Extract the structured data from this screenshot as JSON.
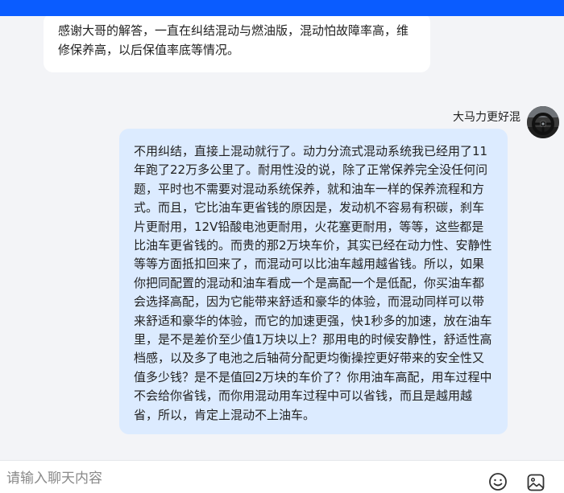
{
  "messages": {
    "first": {
      "text": "感谢大哥的解答，一直在纠结混动与燃油版，混动怕故障率高，维修保养高，以后保值率底等情况。"
    },
    "reply": {
      "sender": "大马力更好混",
      "avatar_icon": "car-steering-wheel-avatar",
      "text": "不用纠结，直接上混动就行了。动力分流式混动系统我已经用了11年跑了22万多公里了。耐用性没的说，除了正常保养完全没任何问题，平时也不需要对混动系统保养，就和油车一样的保养流程和方式。而且，它比油车更省钱的原因是，发动机不容易有积碳，刹车片更耐用，12V铅酸电池更耐用，火花塞更耐用，等等，这些都是比油车更省钱的。而贵的那2万块车价，其实已经在动力性、安静性等等方面抵扣回来了，而混动可以比油车越用越省钱。所以，如果你把同配置的混动和油车看成一个是高配一个是低配，你买油车都会选择高配，因为它能带来舒适和豪华的体验，而混动同样可以带来舒适和豪华的体验，而它的加速更强，快1秒多的加速，放在油车里，是不是差价至少值1万块以上？那用电的时候安静性，舒适性高档感，以及多了电池之后轴荷分配更均衡操控更好带来的安全性又值多少钱？是不是值回2万块的车价了？你用油车高配，用车过程中不会给你省钱，而你用混动用车过程中可以省钱，而且是越用越省，所以，肯定上混动不上油车。"
    }
  },
  "composer": {
    "placeholder": "请输入聊天内容",
    "emoji_icon": "emoji-icon",
    "image_icon": "image-icon"
  },
  "colors": {
    "top_bar": "#0a5cff",
    "background": "#f3f4f7",
    "incoming_bubble": "#ffffff",
    "outgoing_bubble": "#dcebff"
  }
}
